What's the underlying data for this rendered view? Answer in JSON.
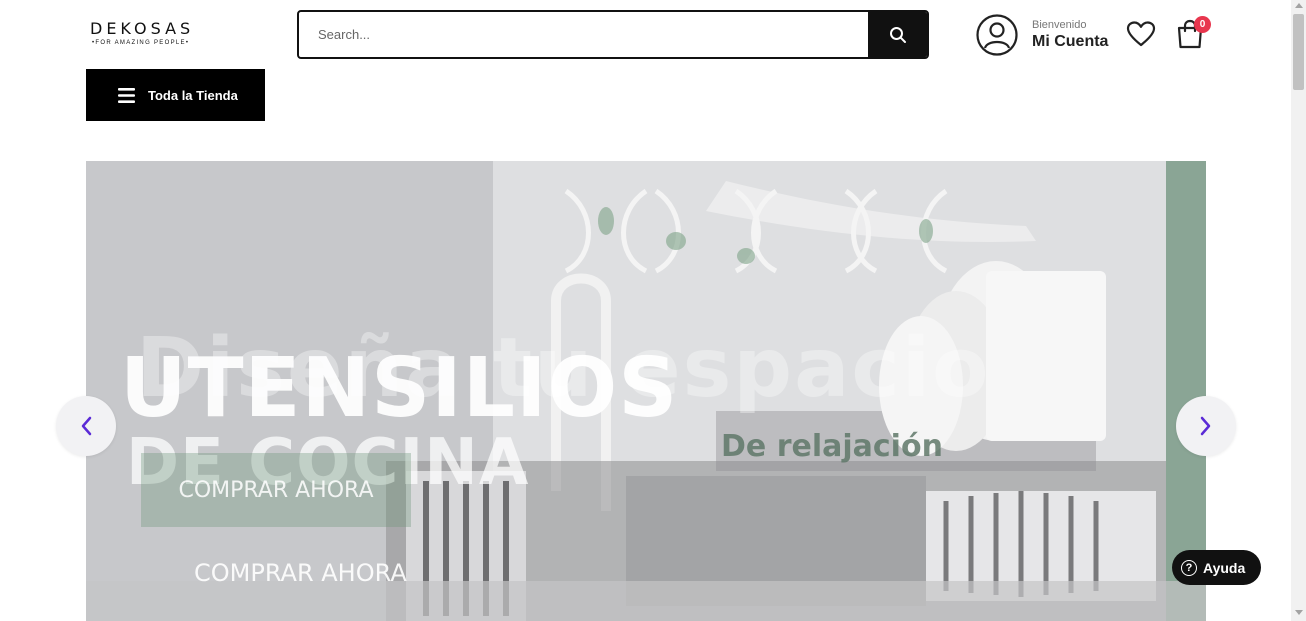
{
  "header": {
    "logo": {
      "name": "DEKOSAS",
      "tagline": "•FOR AMAZING PEOPLE•"
    },
    "search": {
      "placeholder": "Search...",
      "value": "",
      "icon": "search-icon"
    },
    "account": {
      "greeting": "Bienvenido",
      "label": "Mi Cuenta",
      "icon": "user-icon"
    },
    "wishlist": {
      "icon": "heart-icon"
    },
    "cart": {
      "icon": "shopping-bag-icon",
      "count": "0"
    }
  },
  "nav": {
    "store_button": {
      "label": "Toda la Tienda",
      "icon": "menu-icon"
    }
  },
  "banner": {
    "ghost_text_1": "Diseña tu espacio",
    "ghost_text_2": "espacio",
    "title_line_1": "UTENSILIOS",
    "title_line_2": "DE COCINA",
    "subtitle": "De relajación",
    "cta_primary": "COMPRAR AHORA",
    "cta_secondary": "COMPRAR AHORA",
    "prev_icon": "chevron-left-icon",
    "next_icon": "chevron-right-icon"
  },
  "help_widget": {
    "label": "Ayuda",
    "icon": "question-icon"
  },
  "colors": {
    "brand_black": "#111111",
    "badge_red": "#e8364e",
    "arrow_purple": "#5b2bd6",
    "banner_green": "#6e9678"
  }
}
